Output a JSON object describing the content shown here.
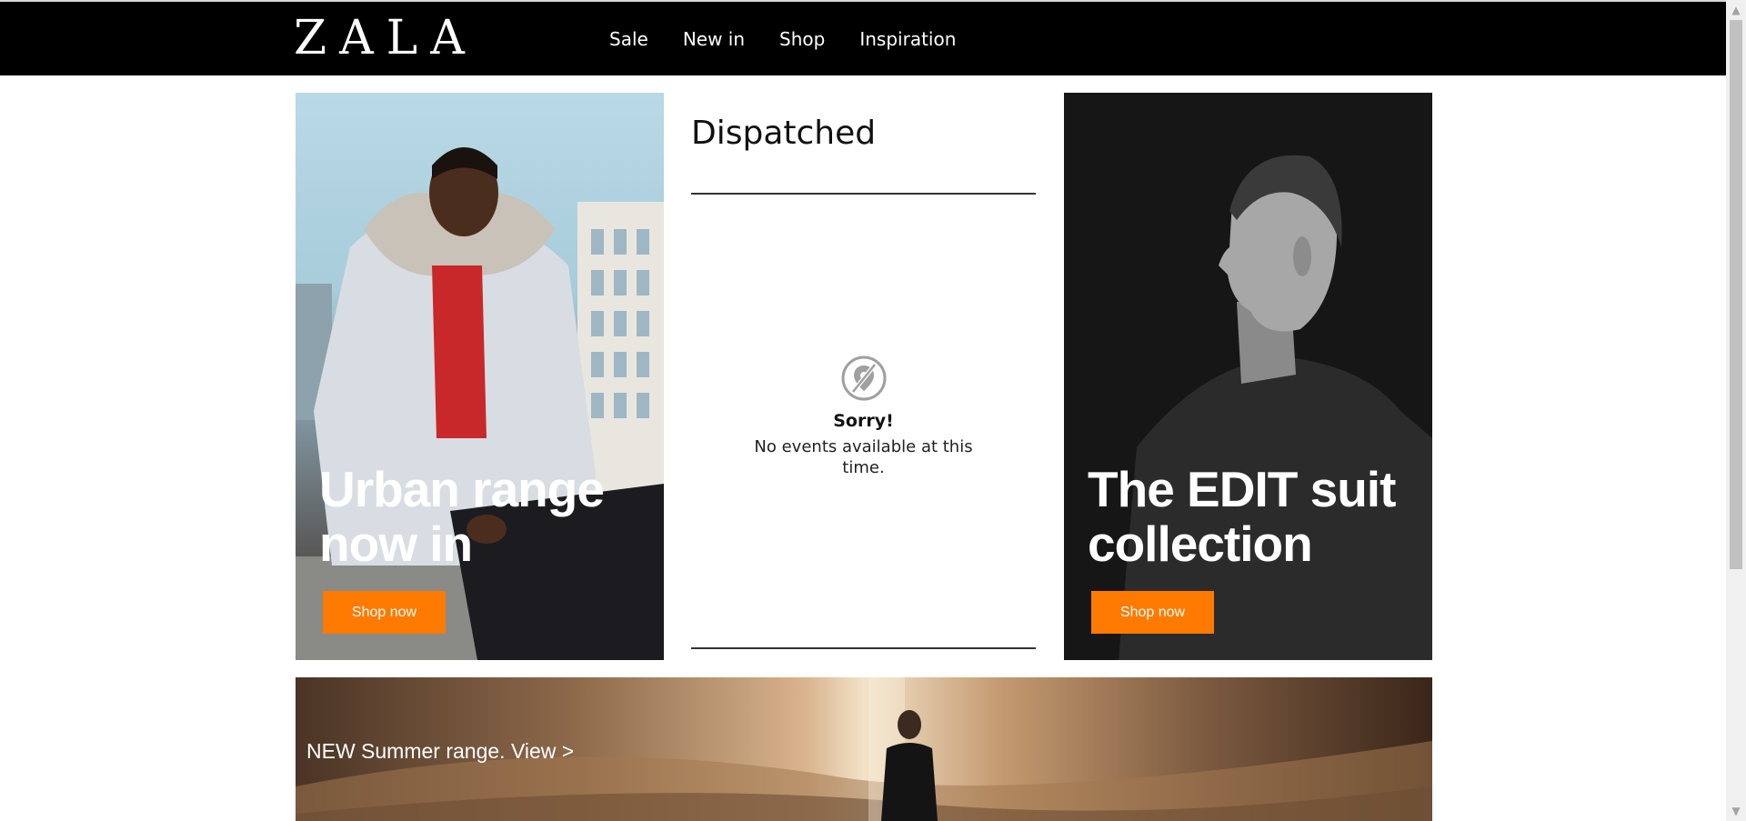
{
  "header": {
    "logo": "ZALA",
    "nav": [
      "Sale",
      "New in",
      "Shop",
      "Inspiration"
    ]
  },
  "promo_left": {
    "title_line1": "Urban range",
    "title_line2": "now in",
    "button": "Shop now"
  },
  "promo_right": {
    "title_line1": "The EDIT suit",
    "title_line2": "collection",
    "button": "Shop now"
  },
  "feed": {
    "title": "Dispatched",
    "empty_title": "Sorry!",
    "empty_text": "No events available at this time."
  },
  "banner": {
    "text": "NEW Summer range. View >"
  },
  "colors": {
    "header_bg": "#000000",
    "accent_button": "#ff7a00"
  },
  "icons": {
    "empty_state": "location-off-icon"
  }
}
